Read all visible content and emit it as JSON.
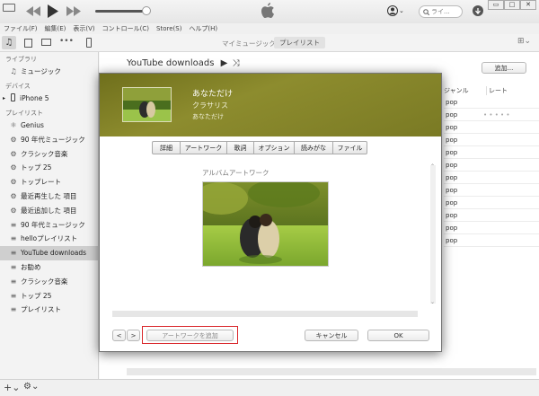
{
  "search": {
    "placeholder": "ライ..."
  },
  "menu": [
    "ファイル(F)",
    "編集(E)",
    "表示(V)",
    "コントロール(C)",
    "Store(S)",
    "ヘルプ(H)"
  ],
  "view": {
    "my_music": "マイミュージック",
    "playlists": "プレイリスト"
  },
  "sidebar": {
    "library_heading": "ライブラリ",
    "library_items": [
      {
        "label": "ミュージック",
        "icon": "music-note-icon"
      }
    ],
    "devices_heading": "デバイス",
    "device": {
      "label": "iPhone 5",
      "icon": "iphone-icon"
    },
    "playlists_heading": "プレイリスト",
    "playlists": [
      {
        "label": "Genius",
        "icon": "genius-icon",
        "selected": false
      },
      {
        "label": "90 年代ミュージック",
        "icon": "gear-icon",
        "selected": false
      },
      {
        "label": "クラシック音楽",
        "icon": "gear-icon",
        "selected": false
      },
      {
        "label": "トップ 25",
        "icon": "gear-icon",
        "selected": false
      },
      {
        "label": "トップレート",
        "icon": "gear-icon",
        "selected": false
      },
      {
        "label": "最近再生した 項目",
        "icon": "gear-icon",
        "selected": false
      },
      {
        "label": "最近追加した 項目",
        "icon": "gear-icon",
        "selected": false
      },
      {
        "label": "90 年代ミュージック",
        "icon": "playlist-icon",
        "selected": false
      },
      {
        "label": "helloプレイリスト",
        "icon": "playlist-icon",
        "selected": false
      },
      {
        "label": "YouTube downloads",
        "icon": "playlist-icon",
        "selected": true
      },
      {
        "label": "お勧め",
        "icon": "playlist-icon",
        "selected": false
      },
      {
        "label": "クラシック音楽",
        "icon": "playlist-icon",
        "selected": false
      },
      {
        "label": "トップ 25",
        "icon": "playlist-icon",
        "selected": false
      },
      {
        "label": "プレイリスト",
        "icon": "playlist-icon",
        "selected": false
      }
    ]
  },
  "main": {
    "title": "YouTube downloads",
    "add_button": "追加...",
    "columns": {
      "genre": "ジャンル",
      "rating": "レート"
    },
    "rows": [
      {
        "genre": "pop",
        "rating": ""
      },
      {
        "genre": "pop",
        "rating": "• • • • •"
      },
      {
        "genre": "pop",
        "rating": ""
      },
      {
        "genre": "pop",
        "rating": ""
      },
      {
        "genre": "pop",
        "rating": ""
      },
      {
        "genre": "pop",
        "rating": ""
      },
      {
        "genre": "pop",
        "rating": ""
      },
      {
        "genre": "pop",
        "rating": ""
      },
      {
        "genre": "pop",
        "rating": ""
      },
      {
        "genre": "pop",
        "rating": ""
      },
      {
        "genre": "pop",
        "rating": ""
      },
      {
        "genre": "pop",
        "rating": ""
      }
    ]
  },
  "dialog": {
    "title": "あなただけ",
    "artist": "クラサリス",
    "album": "あなただけ",
    "tabs": [
      "詳細",
      "アートワーク",
      "歌詞",
      "オプション",
      "読みがな",
      "ファイル"
    ],
    "artwork_label": "アルバムアートワーク",
    "add_artwork_button": "アートワークを追加",
    "cancel_button": "キャンセル",
    "ok_button": "OK",
    "prev_label": "<",
    "next_label": ">"
  },
  "colors": {
    "highlight": "#d9262a",
    "dialog_header": "#7d7d25"
  }
}
